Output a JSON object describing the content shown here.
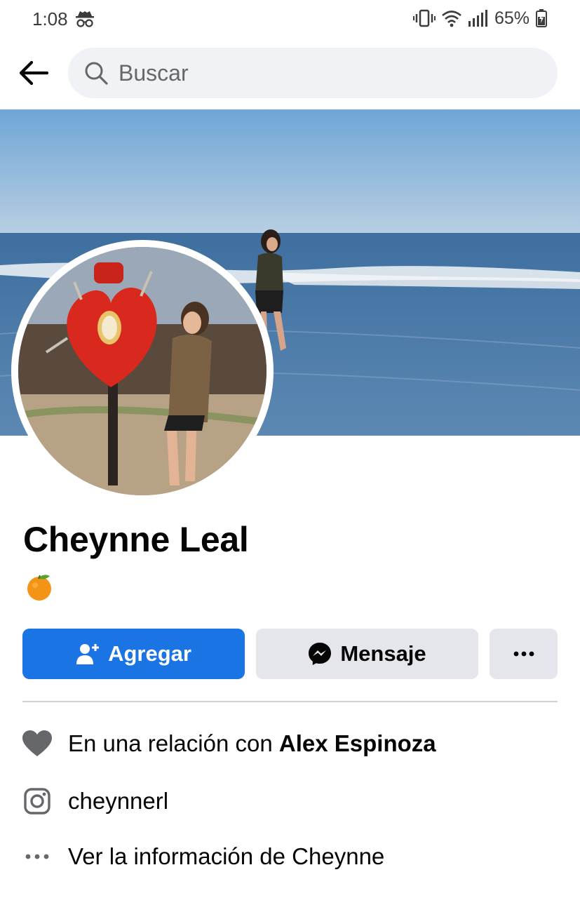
{
  "status_bar": {
    "time": "1:08",
    "battery": "65%",
    "icons": [
      "incognito-icon",
      "vibrate-icon",
      "wifi-icon",
      "signal-icon",
      "battery-charging-icon"
    ]
  },
  "header": {
    "back_icon": "arrow-left-icon",
    "search_icon": "search-icon",
    "search_placeholder": "Buscar"
  },
  "profile": {
    "name": "Cheynne Leal",
    "bio_emoji": "🍊"
  },
  "actions": {
    "add_label": "Agregar",
    "message_label": "Mensaje",
    "more_icon": "more-dots-icon"
  },
  "info": {
    "relationship_prefix": "En una relación con ",
    "relationship_partner": "Alex Espinoza",
    "instagram": "cheynnerl",
    "see_info": "Ver la información de Cheynne"
  },
  "colors": {
    "primary": "#1b74e4",
    "secondary_button": "#e4e6eb",
    "search_bg": "#f0f2f5",
    "icon_gray": "#65676b"
  }
}
